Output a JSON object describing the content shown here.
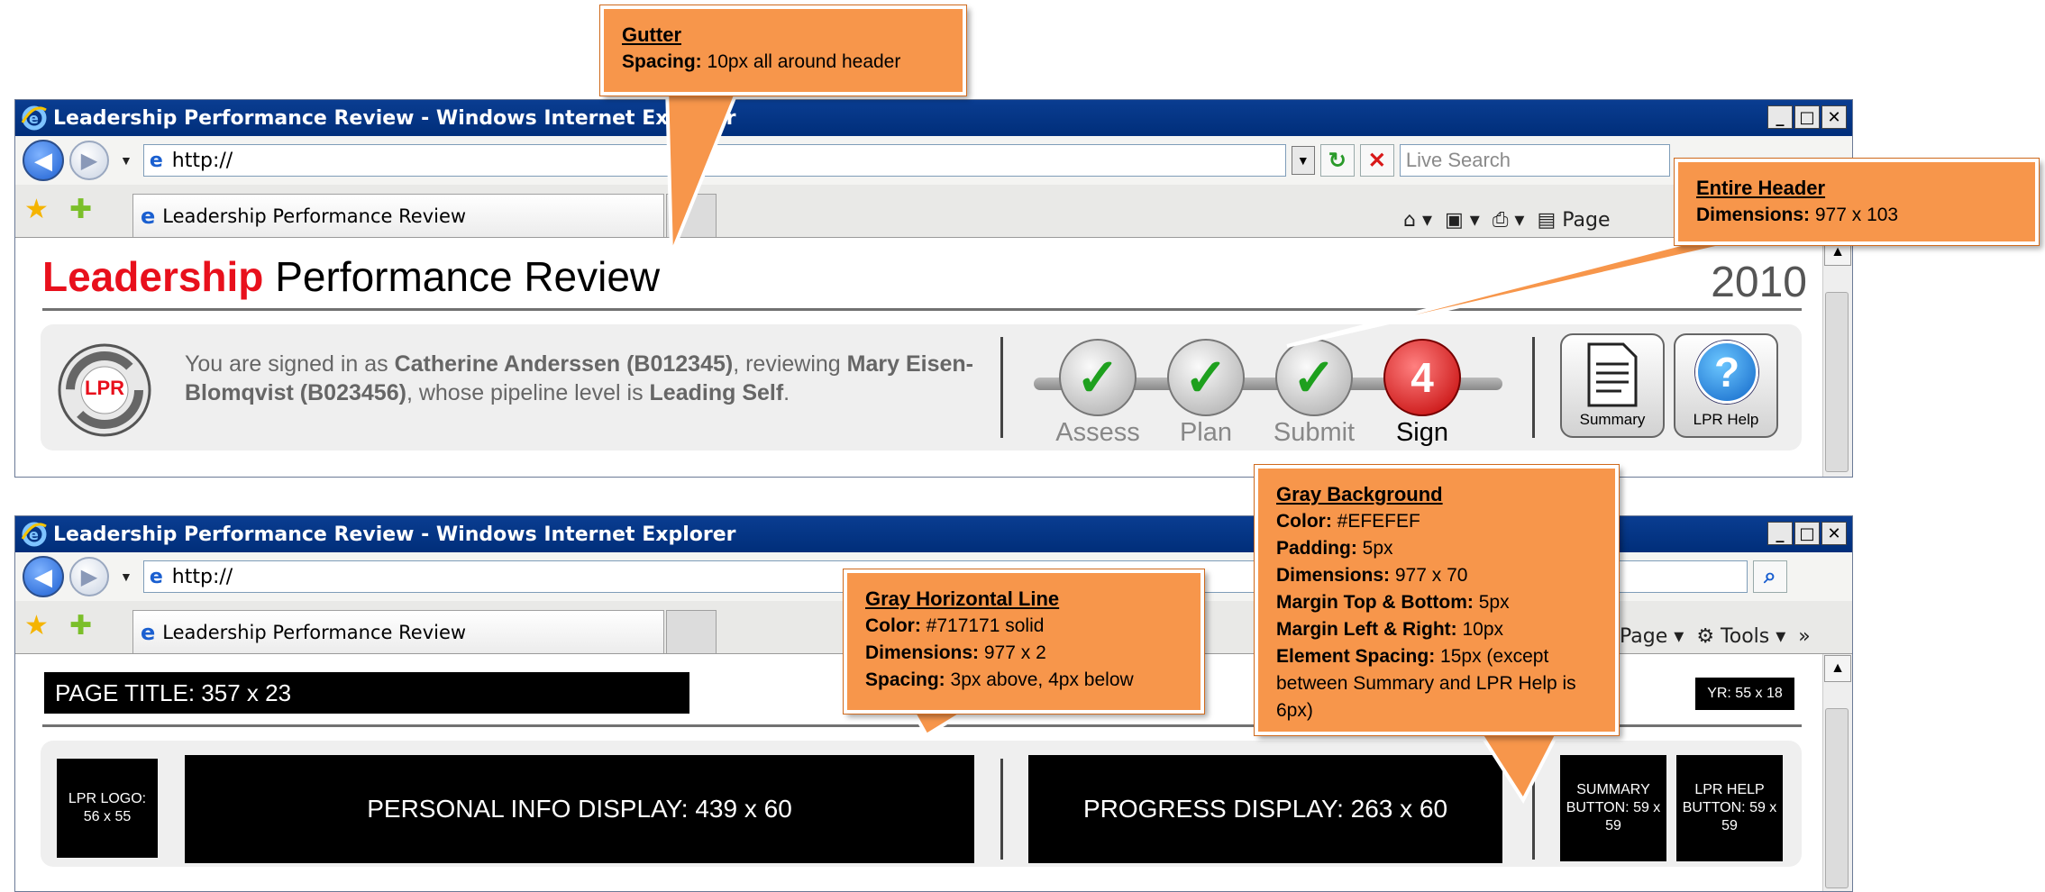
{
  "browser": {
    "window_title": "Leadership Performance Review - Windows Internet Explorer",
    "address": "http://",
    "search_placeholder": "Live Search",
    "tab_title": "Leadership Performance Review",
    "page_label": "Page",
    "tools_label": "Tools",
    "chevron": "»"
  },
  "header": {
    "title_red": "Leadership",
    "title_rest": " Performance Review",
    "year": "2010",
    "logo_text": "LPR",
    "signin_pre": "You are signed in as ",
    "signer": "Catherine Anderssen (B012345)",
    "signin_mid": ", reviewing ",
    "reviewee": "Mary Eisen-Blomqvist (B023456)",
    "signin_mid2": ", whose pipeline level is ",
    "level": "Leading Self",
    "signin_end": ".",
    "steps": [
      {
        "label": "Assess",
        "status": "done"
      },
      {
        "label": "Plan",
        "status": "done"
      },
      {
        "label": "Submit",
        "status": "done"
      },
      {
        "label": "Sign",
        "status": "current",
        "number": "4"
      }
    ],
    "summary_label": "Summary",
    "help_label": "LPR Help",
    "help_glyph": "?"
  },
  "wireframe": {
    "page_title": "PAGE TITLE: 357 x 23",
    "year_box": "YR: 55 x 18",
    "logo_box": "LPR LOGO: 56 x 55",
    "personal_box": "PERSONAL INFO DISPLAY: 439 x 60",
    "progress_box": "PROGRESS DISPLAY: 263 x 60",
    "summary_box": "SUMMARY BUTTON: 59 x 59",
    "help_box": "LPR HELP BUTTON: 59 x 59"
  },
  "callouts": {
    "gutter": {
      "title": "Gutter",
      "k1": "Spacing:",
      "v1": " 10px all around header"
    },
    "entire": {
      "title": "Entire Header",
      "k1": "Dimensions:",
      "v1": " 977 x 103"
    },
    "hline": {
      "title": "Gray Horizontal Line",
      "k1": "Color:",
      "v1": " #717171 solid",
      "k2": "Dimensions:",
      "v2": " 977 x 2",
      "k3": "Spacing:",
      "v3": " 3px above, 4px below"
    },
    "graybg": {
      "title": "Gray Background",
      "k1": "Color:",
      "v1": " #EFEFEF",
      "k2": "Padding:",
      "v2": " 5px",
      "k3": "Dimensions:",
      "v3": " 977 x 70",
      "k4": "Margin Top & Bottom:",
      "v4": " 5px",
      "k5": "Margin Left & Right:",
      "v5": " 10px",
      "k6": "Element Spacing:",
      "v6": " 15px (except between Summary and LPR Help is 6px)"
    }
  },
  "colors": {
    "accent_red": "#e8101c",
    "orange": "#f7964b",
    "gray_bg": "#efefef",
    "line": "#717171",
    "ie_blue": "#0a3d91"
  }
}
